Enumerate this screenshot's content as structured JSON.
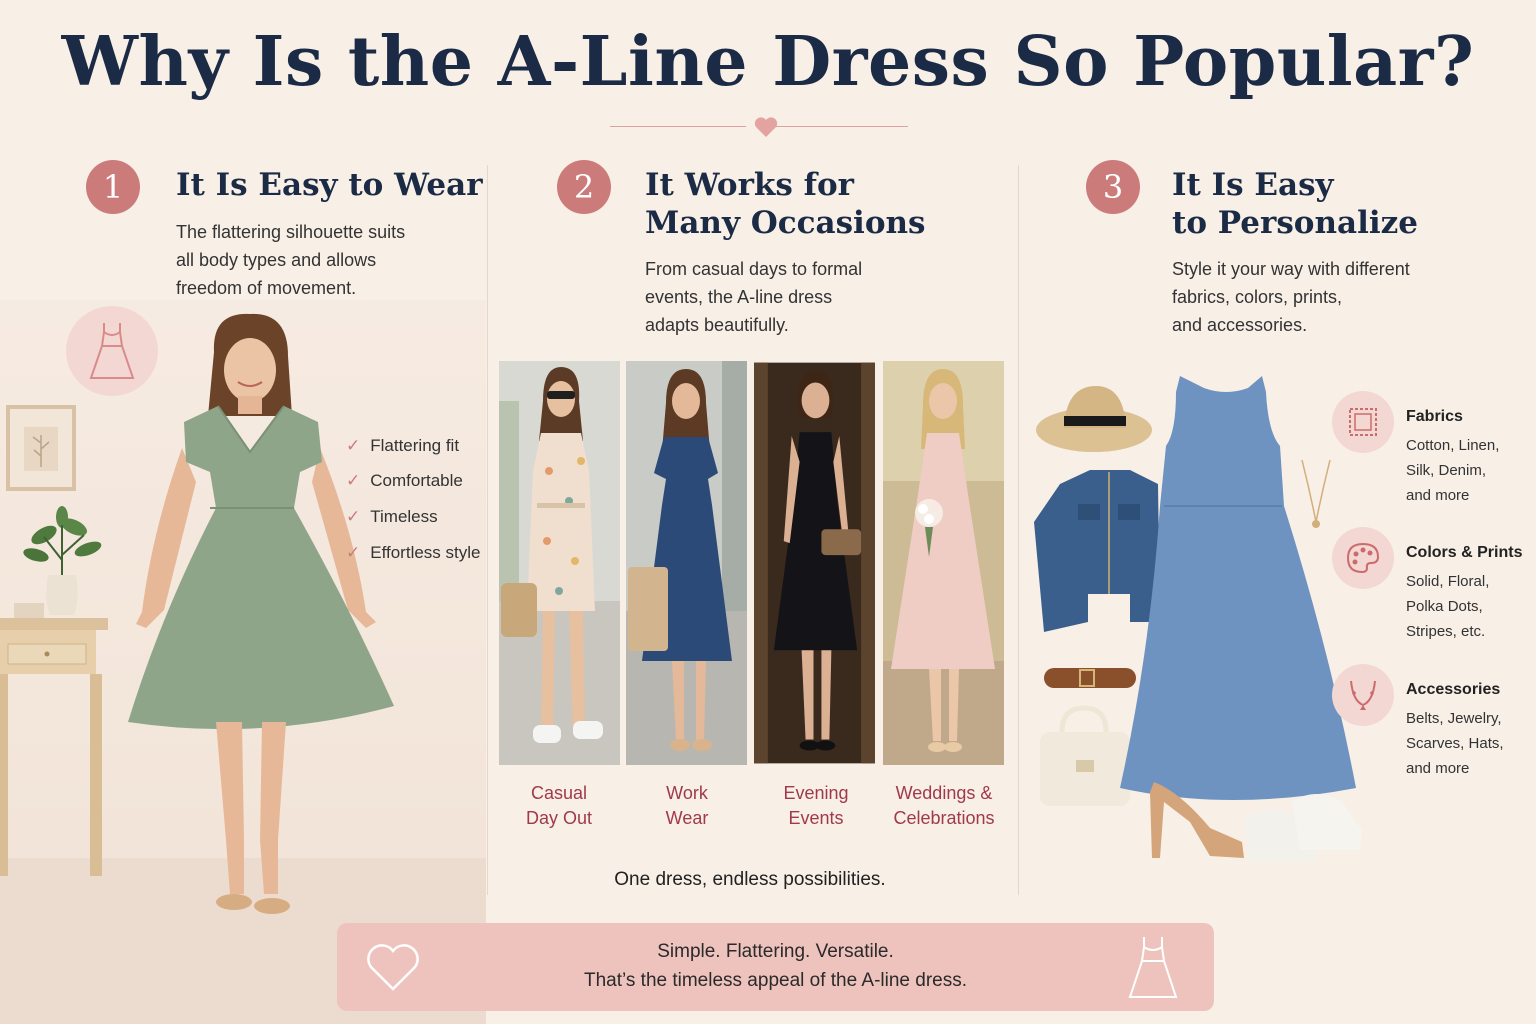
{
  "title": "Why Is the A-Line Dress So Popular?",
  "colors": {
    "accent": "#cc7b7b",
    "heading": "#1c2b45",
    "occasion_label": "#a03a4a",
    "banner": "#eec3bd",
    "background": "#f8efe7"
  },
  "sections": [
    {
      "number": "1",
      "heading_lines": [
        "It Is Easy to Wear"
      ],
      "desc_lines": [
        "The flattering silhouette suits",
        "all body types and allows",
        "freedom of movement."
      ],
      "icon": "dress-outline-icon",
      "checklist": [
        "Flattering fit",
        "Comfortable",
        "Timeless",
        "Effortless style"
      ]
    },
    {
      "number": "2",
      "heading_lines": [
        "It Works for",
        "Many Occasions"
      ],
      "desc_lines": [
        "From casual days to formal",
        "events, the A-line dress",
        "adapts beautifully."
      ],
      "occasions": [
        {
          "lines": [
            "Casual",
            "Day Out"
          ]
        },
        {
          "lines": [
            "Work",
            "Wear"
          ]
        },
        {
          "lines": [
            "Evening",
            "Events"
          ]
        },
        {
          "lines": [
            "Weddings &",
            "Celebrations"
          ]
        }
      ],
      "tagline": "One dress, endless possibilities."
    },
    {
      "number": "3",
      "heading_lines": [
        "It Is Easy",
        "to Personalize"
      ],
      "desc_lines": [
        "Style it your way with different",
        "fabrics, colors, prints,",
        "and accessories."
      ],
      "attributes": [
        {
          "icon": "fabric-swatch-icon",
          "title": "Fabrics",
          "lines": [
            "Cotton, Linen,",
            "Silk, Denim,",
            "and more"
          ]
        },
        {
          "icon": "palette-icon",
          "title": "Colors & Prints",
          "lines": [
            "Solid, Floral,",
            "Polka Dots,",
            "Stripes, etc."
          ]
        },
        {
          "icon": "necklace-icon",
          "title": "Accessories",
          "lines": [
            "Belts, Jewelry,",
            "Scarves, Hats,",
            "and more"
          ]
        }
      ]
    }
  ],
  "banner": {
    "line1": "Simple. Flattering. Versatile.",
    "line2": "That’s the timeless appeal of the A-line dress.",
    "left_icon": "heart-icon",
    "right_icon": "dress-outline-icon"
  }
}
